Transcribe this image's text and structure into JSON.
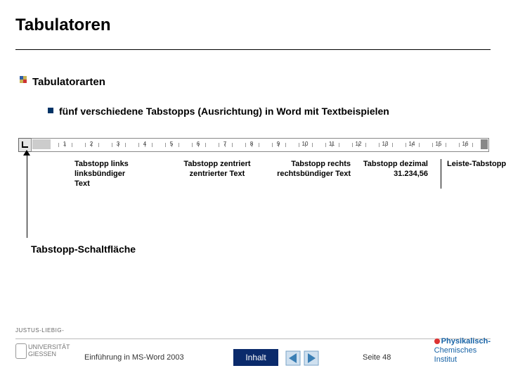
{
  "title": "Tabulatoren",
  "bullets": {
    "l1": "Tabulatorarten",
    "l2": "fünf verschiedene Tabstopps (Ausrichtung) in Word mit Textbeispielen"
  },
  "caption": "Tabstopp-Schaltfläche",
  "ruler_ticks": [
    "1",
    "2",
    "3",
    "4",
    "5",
    "6",
    "7",
    "8",
    "9",
    "10",
    "11",
    "12",
    "13",
    "14",
    "15",
    "16"
  ],
  "examples": {
    "left": "Tabstopp links\nlinksbündiger\nText",
    "center": "Tabstopp zentriert\nzentrierter Text",
    "right": "Tabstopp rechts\nrechtsbündiger Text",
    "decimal": "Tabstopp dezimal\n31.234,56",
    "bar": "Leiste-Tabstopp"
  },
  "footer": {
    "uni1": "JUSTUS-LIEBIG-",
    "uni2": "UNIVERSITÄT",
    "uni3": "GIESSEN",
    "course": "Einführung in MS-Word 2003",
    "button": "Inhalt",
    "page": "Seite 48",
    "institute_l1": "Physikalisch-",
    "institute_l2": "Chemisches",
    "institute_l3": "Institut"
  }
}
